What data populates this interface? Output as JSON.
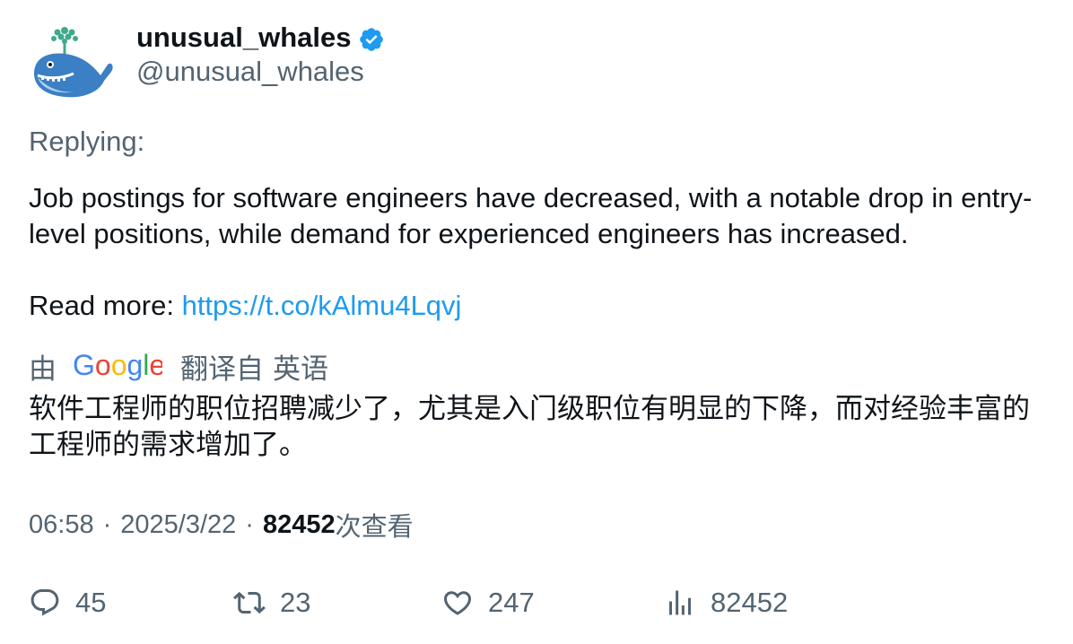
{
  "author": {
    "display_name": "unusual_whales",
    "handle": "@unusual_whales",
    "verified": true,
    "avatar_icon": "whale-logo-icon"
  },
  "tweet": {
    "replying_label": "Replying:",
    "text_line": "Job postings for software engineers have decreased, with a notable drop in entry-level positions, while demand for experienced engineers has increased.",
    "read_more_label": "Read more: ",
    "link_text": "https://t.co/kAlmu4Lqvj"
  },
  "translation": {
    "prefix": "由",
    "google_brand": "Google",
    "suffix_1": "翻译自",
    "suffix_2": "英语",
    "text": "软件工程师的职位招聘减少了，尤其是入门级职位有明显的下降，而对经验丰富的工程师的需求增加了。"
  },
  "meta": {
    "time": "06:58",
    "separator": "·",
    "date": "2025/3/22",
    "views_count": "82452",
    "views_label": "次查看"
  },
  "actions": {
    "replies": "45",
    "retweets": "23",
    "likes": "247",
    "views": "82452"
  },
  "colors": {
    "text_primary": "#0f1419",
    "text_secondary": "#536471",
    "link": "#1d9bf0",
    "verified_badge": "#1d9bf0"
  }
}
